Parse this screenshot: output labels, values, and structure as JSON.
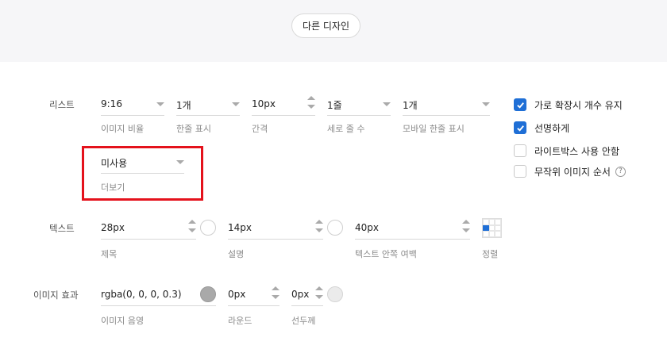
{
  "header": {
    "other_design_label": "다른 디자인"
  },
  "list_section": {
    "label": "리스트",
    "fields": [
      {
        "value": "9:16",
        "caption": "이미지 비율"
      },
      {
        "value": "1개",
        "caption": "한줄 표시"
      },
      {
        "value": "10px",
        "caption": "간격"
      },
      {
        "value": "1줄",
        "caption": "세로 줄 수"
      },
      {
        "value": "1개",
        "caption": "모바일 한줄 표시"
      }
    ],
    "more": {
      "value": "미사용",
      "caption": "더보기"
    }
  },
  "options": [
    {
      "label": "가로 확장시 개수 유지",
      "checked": true
    },
    {
      "label": "선명하게",
      "checked": true
    },
    {
      "label": "라이트박스 사용 안함",
      "checked": false
    },
    {
      "label": "무작위 이미지 순서",
      "checked": false
    }
  ],
  "text_section": {
    "label": "텍스트",
    "title": {
      "value": "28px",
      "caption": "제목"
    },
    "desc": {
      "value": "14px",
      "caption": "설명"
    },
    "padding": {
      "value": "40px",
      "caption": "텍스트 안쪽 여백"
    },
    "align": {
      "caption": "정렬",
      "selected": "middle-left"
    }
  },
  "effect_section": {
    "label": "이미지 효과",
    "shadow": {
      "value": "rgba(0, 0, 0, 0.3)",
      "caption": "이미지 음영"
    },
    "radius": {
      "value": "0px",
      "caption": "라운드"
    },
    "border": {
      "value": "0px",
      "caption": "선두께"
    }
  },
  "colors": {
    "accent": "#1f6fd6",
    "highlight": "#e4121c",
    "band": "#f6f6f8"
  }
}
